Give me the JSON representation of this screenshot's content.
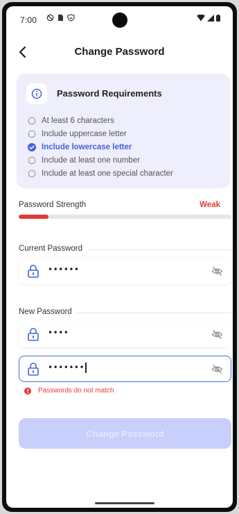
{
  "status_bar": {
    "time": "7:00"
  },
  "header": {
    "title": "Change Password"
  },
  "requirements": {
    "title": "Password Requirements",
    "items": [
      {
        "label": "At least 6 characters",
        "met": false
      },
      {
        "label": "Include uppercase letter",
        "met": false
      },
      {
        "label": "Include lowercase letter",
        "met": true
      },
      {
        "label": "Include at least one number",
        "met": false
      },
      {
        "label": "Include at least one special character",
        "met": false
      }
    ]
  },
  "strength": {
    "label": "Password Strength",
    "value": "Weak",
    "level": 0.14,
    "color": "#e53935"
  },
  "current_password": {
    "section_label": "Current Password",
    "value": "••••••"
  },
  "new_password": {
    "section_label": "New Password",
    "value": "••••",
    "confirm_value": "•••••••",
    "error": "Passwords do not match"
  },
  "submit": {
    "label": "Change Password",
    "enabled": false
  },
  "colors": {
    "accent": "#4660d8",
    "error": "#e53935",
    "card_bg": "#eeeefc",
    "button_disabled": "#c8cffb"
  }
}
